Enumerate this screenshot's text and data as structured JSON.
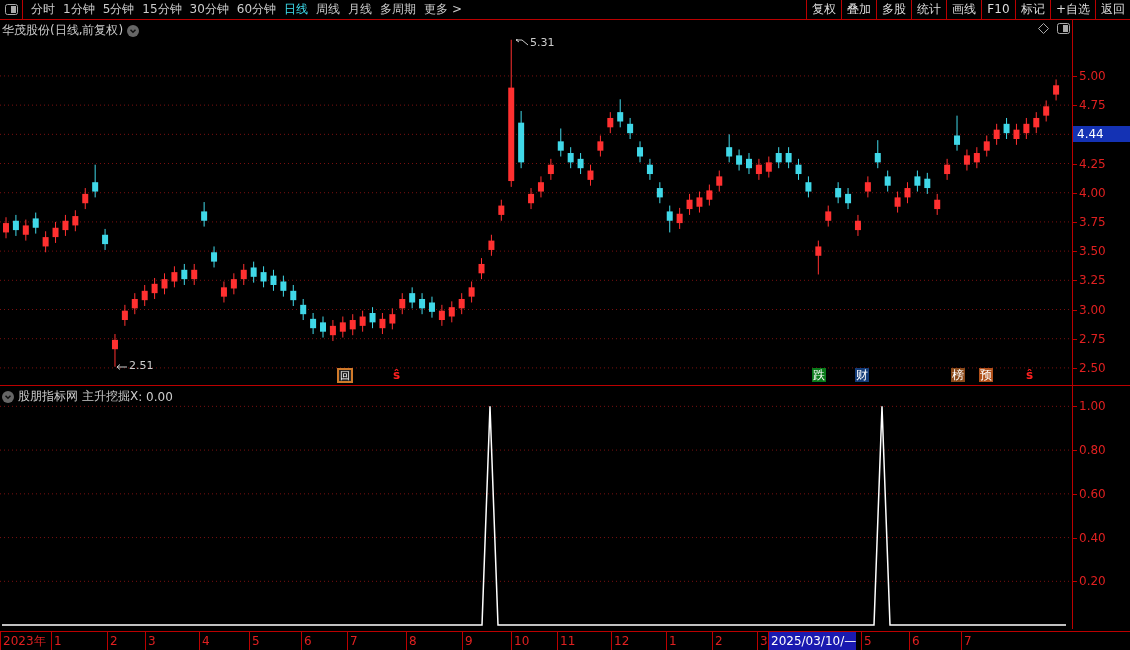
{
  "toolbar": {
    "periods": [
      {
        "label": "分时",
        "selected": false
      },
      {
        "label": "1分钟",
        "selected": false
      },
      {
        "label": "5分钟",
        "selected": false
      },
      {
        "label": "15分钟",
        "selected": false
      },
      {
        "label": "30分钟",
        "selected": false
      },
      {
        "label": "60分钟",
        "selected": false
      },
      {
        "label": "日线",
        "selected": true
      },
      {
        "label": "周线",
        "selected": false
      },
      {
        "label": "月线",
        "selected": false
      },
      {
        "label": "多周期",
        "selected": false
      }
    ],
    "more": "更多 >",
    "buttons": [
      "复权",
      "叠加",
      "多股",
      "统计",
      "画线",
      "F10",
      "标记",
      "+自选",
      "返回"
    ]
  },
  "price_chart": {
    "title": "华茂股份(日线,前复权)",
    "high_label": "5.31",
    "low_label": "2.51",
    "current_price": "4.44",
    "chart_data": {
      "type": "candlestick",
      "grid": true,
      "ylim": [
        2.345,
        5.479
      ],
      "yticks": [
        {
          "value": 5,
          "label": "5.00"
        },
        {
          "value": 4.75,
          "label": "4.75"
        },
        {
          "value": 4.25,
          "label": "4.25"
        },
        {
          "value": 4,
          "label": "4.00"
        },
        {
          "value": 3.75,
          "label": "3.75"
        },
        {
          "value": 3.5,
          "label": "3.50"
        },
        {
          "value": 3.25,
          "label": "3.25"
        },
        {
          "value": 3,
          "label": "3.00"
        },
        {
          "value": 2.75,
          "label": "2.75"
        },
        {
          "value": 2.5,
          "label": "2.50"
        }
      ],
      "categories": [
        null,
        null,
        null,
        null,
        null,
        null,
        null,
        null,
        null,
        null,
        null,
        null,
        null,
        null,
        null,
        null,
        null,
        null,
        null,
        null,
        null,
        null,
        null,
        null,
        null,
        null,
        null,
        null,
        null,
        null,
        null,
        null,
        null,
        null,
        null,
        null,
        null,
        null,
        null,
        null,
        null,
        null,
        null,
        null,
        null,
        null,
        null,
        null,
        null,
        null,
        null,
        null,
        null,
        null,
        null,
        null,
        null,
        null,
        null,
        null,
        null,
        null,
        null,
        null,
        null,
        null,
        null,
        null,
        null,
        null,
        null,
        null,
        null,
        null,
        null,
        null,
        null,
        null,
        null,
        null,
        null,
        null,
        null,
        null,
        null,
        null,
        null,
        null,
        null,
        null,
        null,
        null,
        null,
        null,
        null,
        null,
        null,
        null,
        null,
        null,
        null,
        null,
        null,
        null,
        null,
        null,
        null
      ],
      "ohlc": [
        [
          3.66,
          3.79,
          3.61,
          3.74
        ],
        [
          3.76,
          3.81,
          3.63,
          3.68
        ],
        [
          3.64,
          3.77,
          3.59,
          3.72
        ],
        [
          3.78,
          3.83,
          3.65,
          3.7
        ],
        [
          3.54,
          3.67,
          3.49,
          3.62
        ],
        [
          3.62,
          3.75,
          3.57,
          3.7
        ],
        [
          3.68,
          3.81,
          3.63,
          3.76
        ],
        [
          3.72,
          3.85,
          3.67,
          3.8
        ],
        [
          3.91,
          4.04,
          3.86,
          3.99
        ],
        [
          4.09,
          4.24,
          3.96,
          4.01
        ],
        [
          3.64,
          3.69,
          3.51,
          3.56
        ],
        [
          2.66,
          2.79,
          2.51,
          2.74
        ],
        [
          2.91,
          3.04,
          2.86,
          2.99
        ],
        [
          3.01,
          3.14,
          2.96,
          3.09
        ],
        [
          3.08,
          3.21,
          3.03,
          3.16
        ],
        [
          3.14,
          3.27,
          3.09,
          3.22
        ],
        [
          3.18,
          3.31,
          3.13,
          3.26
        ],
        [
          3.24,
          3.37,
          3.19,
          3.32
        ],
        [
          3.34,
          3.39,
          3.21,
          3.26
        ],
        [
          3.26,
          3.39,
          3.21,
          3.34
        ],
        [
          3.84,
          3.92,
          3.71,
          3.76
        ],
        [
          3.49,
          3.54,
          3.36,
          3.41
        ],
        [
          3.11,
          3.24,
          3.06,
          3.19
        ],
        [
          3.18,
          3.31,
          3.13,
          3.26
        ],
        [
          3.26,
          3.39,
          3.21,
          3.34
        ],
        [
          3.36,
          3.41,
          3.23,
          3.28
        ],
        [
          3.32,
          3.37,
          3.19,
          3.24
        ],
        [
          3.29,
          3.34,
          3.16,
          3.21
        ],
        [
          3.24,
          3.29,
          3.11,
          3.16
        ],
        [
          3.16,
          3.21,
          3.03,
          3.08
        ],
        [
          3.04,
          3.09,
          2.91,
          2.96
        ],
        [
          2.92,
          2.97,
          2.79,
          2.84
        ],
        [
          2.89,
          2.94,
          2.76,
          2.81
        ],
        [
          2.78,
          2.91,
          2.73,
          2.86
        ],
        [
          2.81,
          2.94,
          2.76,
          2.89
        ],
        [
          2.83,
          2.96,
          2.78,
          2.91
        ],
        [
          2.86,
          2.99,
          2.81,
          2.94
        ],
        [
          2.97,
          3.02,
          2.84,
          2.89
        ],
        [
          2.84,
          2.97,
          2.79,
          2.92
        ],
        [
          2.88,
          3.01,
          2.83,
          2.96
        ],
        [
          3.01,
          3.14,
          2.96,
          3.09
        ],
        [
          3.14,
          3.19,
          3.01,
          3.06
        ],
        [
          3.09,
          3.14,
          2.96,
          3.01
        ],
        [
          3.06,
          3.11,
          2.93,
          2.98
        ],
        [
          2.91,
          3.04,
          2.86,
          2.99
        ],
        [
          2.94,
          3.07,
          2.89,
          3.02
        ],
        [
          3.01,
          3.14,
          2.96,
          3.09
        ],
        [
          3.11,
          3.24,
          3.06,
          3.19
        ],
        [
          3.31,
          3.44,
          3.26,
          3.39
        ],
        [
          3.51,
          3.64,
          3.46,
          3.59
        ],
        [
          3.81,
          3.94,
          3.76,
          3.89
        ],
        [
          4.1,
          5.31,
          4.05,
          4.9
        ],
        [
          4.6,
          4.7,
          4.21,
          4.26
        ],
        [
          3.91,
          4.04,
          3.86,
          3.99
        ],
        [
          4.01,
          4.14,
          3.96,
          4.09
        ],
        [
          4.16,
          4.29,
          4.11,
          4.24
        ],
        [
          4.44,
          4.55,
          4.31,
          4.36
        ],
        [
          4.34,
          4.39,
          4.21,
          4.26
        ],
        [
          4.29,
          4.34,
          4.16,
          4.21
        ],
        [
          4.11,
          4.24,
          4.06,
          4.19
        ],
        [
          4.36,
          4.49,
          4.31,
          4.44
        ],
        [
          4.56,
          4.69,
          4.51,
          4.64
        ],
        [
          4.69,
          4.8,
          4.56,
          4.61
        ],
        [
          4.59,
          4.64,
          4.46,
          4.51
        ],
        [
          4.39,
          4.44,
          4.26,
          4.31
        ],
        [
          4.24,
          4.29,
          4.11,
          4.16
        ],
        [
          4.04,
          4.09,
          3.91,
          3.96
        ],
        [
          3.84,
          3.89,
          3.66,
          3.76
        ],
        [
          3.74,
          3.87,
          3.69,
          3.82
        ],
        [
          3.86,
          3.99,
          3.81,
          3.94
        ],
        [
          3.88,
          4.01,
          3.83,
          3.96
        ],
        [
          3.94,
          4.07,
          3.89,
          4.02
        ],
        [
          4.06,
          4.19,
          4.01,
          4.14
        ],
        [
          4.39,
          4.5,
          4.26,
          4.31
        ],
        [
          4.32,
          4.37,
          4.19,
          4.24
        ],
        [
          4.29,
          4.34,
          4.16,
          4.21
        ],
        [
          4.16,
          4.29,
          4.11,
          4.24
        ],
        [
          4.18,
          4.31,
          4.13,
          4.26
        ],
        [
          4.34,
          4.39,
          4.21,
          4.26
        ],
        [
          4.34,
          4.39,
          4.21,
          4.26
        ],
        [
          4.24,
          4.29,
          4.11,
          4.16
        ],
        [
          4.09,
          4.14,
          3.96,
          4.01
        ],
        [
          3.46,
          3.59,
          3.3,
          3.54
        ],
        [
          3.76,
          3.89,
          3.71,
          3.84
        ],
        [
          4.04,
          4.09,
          3.91,
          3.96
        ],
        [
          3.99,
          4.04,
          3.86,
          3.91
        ],
        [
          3.68,
          3.81,
          3.63,
          3.76
        ],
        [
          4.01,
          4.14,
          3.96,
          4.09
        ],
        [
          4.34,
          4.45,
          4.21,
          4.26
        ],
        [
          4.14,
          4.19,
          4.01,
          4.06
        ],
        [
          3.88,
          4.01,
          3.83,
          3.96
        ],
        [
          3.96,
          4.09,
          3.91,
          4.04
        ],
        [
          4.14,
          4.19,
          4.01,
          4.06
        ],
        [
          4.12,
          4.17,
          3.99,
          4.04
        ],
        [
          3.86,
          3.99,
          3.81,
          3.94
        ],
        [
          4.16,
          4.29,
          4.11,
          4.24
        ],
        [
          4.49,
          4.66,
          4.36,
          4.41
        ],
        [
          4.24,
          4.37,
          4.19,
          4.32
        ],
        [
          4.26,
          4.39,
          4.21,
          4.34
        ],
        [
          4.36,
          4.49,
          4.31,
          4.44
        ],
        [
          4.46,
          4.59,
          4.41,
          4.54
        ],
        [
          4.59,
          4.64,
          4.46,
          4.51
        ],
        [
          4.46,
          4.59,
          4.41,
          4.54
        ],
        [
          4.51,
          4.64,
          4.46,
          4.59
        ],
        [
          4.56,
          4.69,
          4.51,
          4.64
        ],
        [
          4.66,
          4.79,
          4.61,
          4.74
        ],
        [
          4.84,
          4.97,
          4.79,
          4.92
        ]
      ]
    },
    "markers": [
      {
        "text": "回",
        "kind": "boxed",
        "color": "#d07a2a"
      },
      {
        "text": "ŝ",
        "kind": "signal",
        "color": "#ff2020"
      },
      {
        "text": "跌",
        "kind": "filled",
        "color": "#0a7a1a"
      },
      {
        "text": "财",
        "kind": "filled",
        "color": "#143c78"
      },
      {
        "text": "榜",
        "kind": "filled",
        "color": "#8a4a1a"
      },
      {
        "text": "预",
        "kind": "filled",
        "color": "#b0501a"
      },
      {
        "text": "ŝ",
        "kind": "signal",
        "color": "#ff2020"
      }
    ]
  },
  "indicator": {
    "title": "股朋指标网",
    "reading": ": 0.00",
    "chart_data": {
      "type": "line",
      "grid": true,
      "categories": [
        null,
        null,
        null,
        null,
        null,
        null,
        null,
        null,
        null,
        null,
        null,
        null,
        null,
        null,
        null,
        null,
        null,
        null,
        null,
        null,
        null,
        null,
        null,
        null,
        null,
        null,
        null,
        null,
        null,
        null,
        null,
        null,
        null,
        null,
        null,
        null,
        null,
        null,
        null,
        null,
        null,
        null,
        null,
        null,
        null,
        null,
        null,
        null,
        null,
        null,
        null,
        null,
        null,
        null,
        null,
        null,
        null,
        null,
        null,
        null,
        null,
        null,
        null,
        null,
        null,
        null,
        null,
        null,
        null,
        null,
        null,
        null,
        null,
        null,
        null,
        null,
        null,
        null,
        null,
        null,
        null,
        null,
        null,
        null,
        null,
        null,
        null,
        null,
        null,
        null,
        null,
        null,
        null,
        null,
        null,
        null,
        null,
        null,
        null,
        null,
        null,
        null,
        null,
        null,
        null,
        null,
        null,
        null,
        null,
        null,
        null,
        null,
        null,
        null,
        null,
        null,
        null,
        null,
        null,
        null,
        null,
        null,
        null,
        null,
        null,
        null,
        null,
        null,
        null,
        null,
        null,
        null,
        null,
        null
      ],
      "series": [
        {
          "name": "主升挖掘X",
          "color": "#ffffff",
          "values": [
            0,
            0,
            0,
            0,
            0,
            0,
            0,
            0,
            0,
            0,
            0,
            0,
            0,
            0,
            0,
            0,
            0,
            0,
            0,
            0,
            0,
            0,
            0,
            0,
            0,
            0,
            0,
            0,
            0,
            0,
            0,
            0,
            0,
            0,
            0,
            0,
            0,
            0,
            0,
            0,
            0,
            0,
            0,
            0,
            0,
            0,
            0,
            0,
            0,
            0,
            0,
            0,
            0,
            0,
            0,
            0,
            0,
            0,
            0,
            0,
            0,
            1,
            0,
            0,
            0,
            0,
            0,
            0,
            0,
            0,
            0,
            0,
            0,
            0,
            0,
            0,
            0,
            0,
            0,
            0,
            0,
            0,
            0,
            0,
            0,
            0,
            0,
            0,
            0,
            0,
            0,
            0,
            0,
            0,
            0,
            0,
            0,
            0,
            0,
            0,
            0,
            0,
            0,
            0,
            0,
            0,
            0,
            0,
            0,
            0,
            1,
            0,
            0,
            0,
            0,
            0,
            0,
            0,
            0,
            0,
            0,
            0,
            0,
            0,
            0,
            0,
            0,
            0,
            0,
            0,
            0,
            0,
            0,
            0
          ]
        }
      ],
      "ylim": [
        -0.018,
        1.093
      ],
      "yticks": [
        {
          "value": 1,
          "label": "1.00"
        },
        {
          "value": 0.8,
          "label": "0.80"
        },
        {
          "value": 0.6,
          "label": "0.60"
        },
        {
          "value": 0.4,
          "label": "0.40"
        },
        {
          "value": 0.2,
          "label": "0.20"
        }
      ]
    }
  },
  "date_axis": {
    "labels": [
      {
        "text": "2023年",
        "selected": false
      },
      {
        "text": "1",
        "selected": false
      },
      {
        "text": "2",
        "selected": false
      },
      {
        "text": "3",
        "selected": false
      },
      {
        "text": "4",
        "selected": false
      },
      {
        "text": "5",
        "selected": false
      },
      {
        "text": "6",
        "selected": false
      },
      {
        "text": "7",
        "selected": false
      },
      {
        "text": "8",
        "selected": false
      },
      {
        "text": "9",
        "selected": false
      },
      {
        "text": "10",
        "selected": false
      },
      {
        "text": "11",
        "selected": false
      },
      {
        "text": "12",
        "selected": false
      },
      {
        "text": "1",
        "selected": false
      },
      {
        "text": "2",
        "selected": false
      },
      {
        "text": "3",
        "selected": false
      },
      {
        "text": "2025/03/10/—",
        "selected": true
      },
      {
        "text": "5",
        "selected": false
      },
      {
        "text": "6",
        "selected": false
      },
      {
        "text": "7",
        "selected": false
      }
    ]
  }
}
